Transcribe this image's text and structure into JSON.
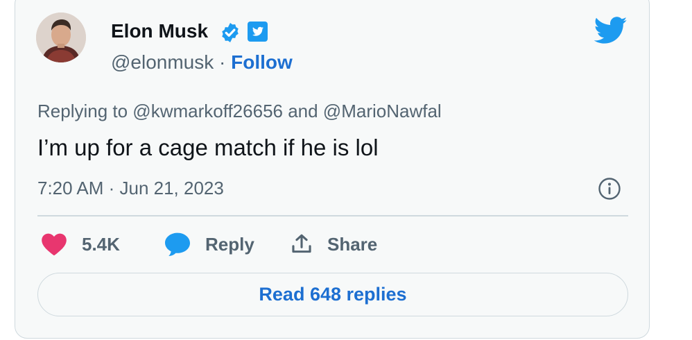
{
  "author": {
    "name": "Elon Musk",
    "handle": "@elonmusk",
    "separator": "·",
    "follow_label": "Follow"
  },
  "tweet": {
    "replying_to": "Replying to @kwmarkoff26656 and @MarioNawfal",
    "text": "I’m up for a cage match if he is lol",
    "timestamp": "7:20 AM · Jun 21, 2023"
  },
  "actions": {
    "like_count": "5.4K",
    "reply_label": "Reply",
    "share_label": "Share"
  },
  "read_replies_label": "Read 648 replies",
  "icons": {
    "verified": "verified-badge-icon",
    "twitter_square": "twitter-square-icon",
    "bird": "twitter-bird-icon",
    "info": "info-icon",
    "like": "heart-icon",
    "reply": "speech-bubble-icon",
    "share": "share-upload-icon"
  },
  "colors": {
    "accent_blue": "#1d9bf0",
    "link_blue": "#1d6fd1",
    "like_pink": "#e8366f",
    "secondary_text": "#536471",
    "card_background": "#f7f9f9",
    "border": "#cfd9de"
  }
}
